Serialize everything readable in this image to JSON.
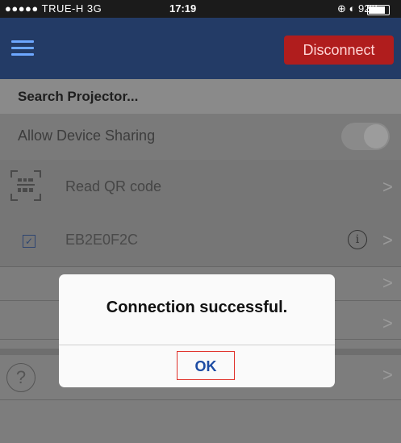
{
  "status_bar": {
    "carrier": "●●●●● TRUE-H  3G",
    "time": "17:19",
    "battery_text": "⊕ ◐ 92%",
    "battery_level": 0.92
  },
  "nav": {
    "menu_icon": "hamburger-icon",
    "disconnect_label": "Disconnect"
  },
  "list": {
    "search_label": "Search Projector...",
    "share_label": "Allow Device Sharing",
    "share_enabled": true,
    "qr_label": "Read QR code",
    "device_label": "EB2E0F2C"
  },
  "dialog": {
    "message": "Connection successful.",
    "ok_label": "OK"
  },
  "glyphs": {
    "chevron": ">",
    "info": "i",
    "help": "?",
    "check": "✓"
  },
  "colors": {
    "nav_bar": "#233b66",
    "disconnect": "#b01d1d",
    "ok_text": "#1c4ba3",
    "ok_highlight": "#e0312a"
  }
}
